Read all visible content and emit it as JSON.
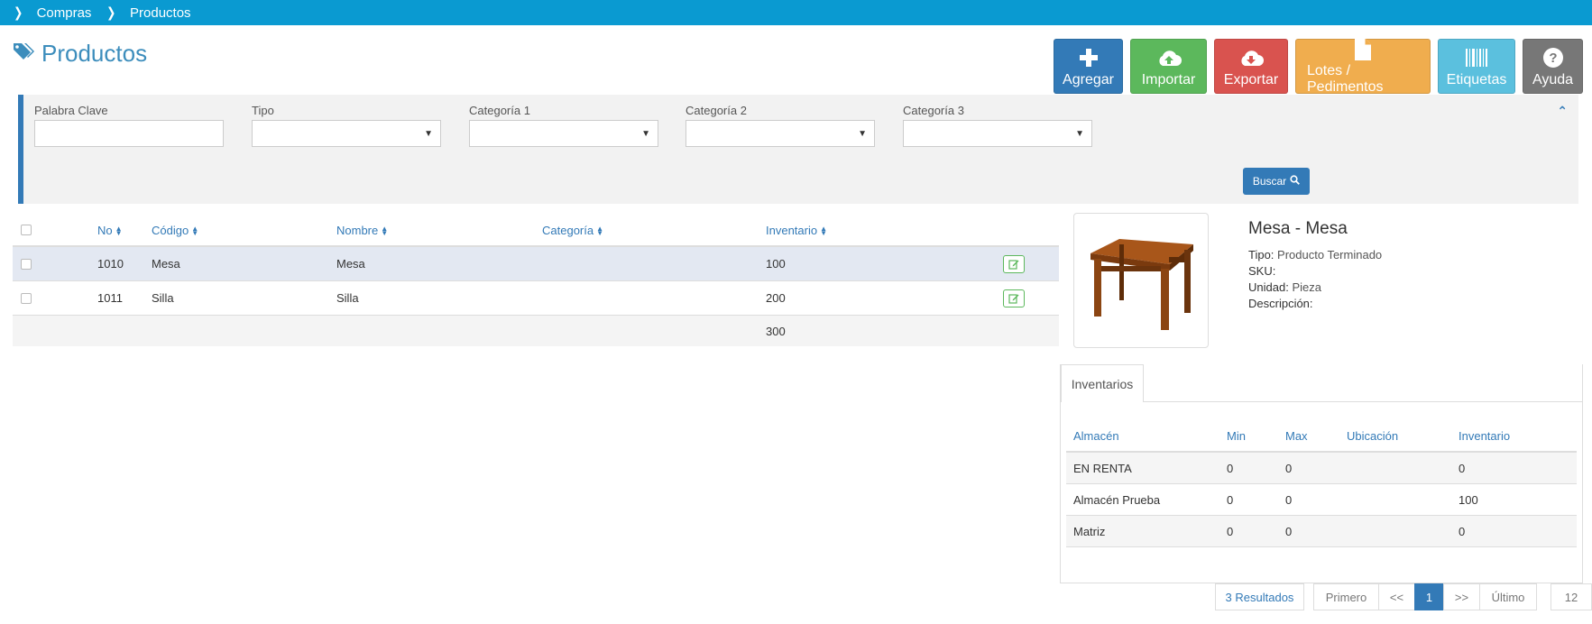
{
  "breadcrumb": {
    "items": [
      "Compras",
      "Productos"
    ]
  },
  "page": {
    "title": "Productos"
  },
  "toolbar": {
    "agregar": "Agregar",
    "importar": "Importar",
    "exportar": "Exportar",
    "lotes": "Lotes / Pedimentos",
    "etiquetas": "Etiquetas",
    "ayuda": "Ayuda"
  },
  "filters": {
    "keyword_label": "Palabra Clave",
    "tipo_label": "Tipo",
    "cat1_label": "Categoría 1",
    "cat2_label": "Categoría 2",
    "cat3_label": "Categoría 3",
    "search_button": "Buscar"
  },
  "grid": {
    "columns": {
      "no": "No",
      "codigo": "Código",
      "nombre": "Nombre",
      "categoria": "Categoría",
      "inventario": "Inventario"
    },
    "rows": [
      {
        "no": "1010",
        "codigo": "Mesa",
        "nombre": "Mesa",
        "categoria": "",
        "inventario": "100"
      },
      {
        "no": "1011",
        "codigo": "Silla",
        "nombre": "Silla",
        "categoria": "",
        "inventario": "200"
      }
    ],
    "total_inventario": "300"
  },
  "detail": {
    "title": "Mesa - Mesa",
    "tipo_label": "Tipo:",
    "tipo_value": "Producto Terminado",
    "sku_label": "SKU:",
    "unidad_label": "Unidad:",
    "unidad_value": "Pieza",
    "descripcion_label": "Descripción:"
  },
  "inventory": {
    "tab": "Inventarios",
    "columns": {
      "almacen": "Almacén",
      "min": "Min",
      "max": "Max",
      "ubicacion": "Ubicación",
      "inventario": "Inventario"
    },
    "rows": [
      {
        "almacen": "EN RENTA",
        "min": "0",
        "max": "0",
        "ubicacion": "",
        "inventario": "0"
      },
      {
        "almacen": "Almacén Prueba",
        "min": "0",
        "max": "0",
        "ubicacion": "",
        "inventario": "100"
      },
      {
        "almacen": "Matriz",
        "min": "0",
        "max": "0",
        "ubicacion": "",
        "inventario": "0"
      }
    ]
  },
  "pagination": {
    "results": "3 Resultados",
    "first": "Primero",
    "prev": "<<",
    "current": "1",
    "next": ">>",
    "last": "Último",
    "page_size": "12"
  },
  "colors": {
    "topbar": "#0a9ad1",
    "primary": "#337ab7",
    "success": "#5cb85c",
    "danger": "#d9534f",
    "warning": "#f0ad4e",
    "info": "#5bc0de",
    "default": "#777777"
  },
  "icons": [
    "chevron-right-icon",
    "tags-icon",
    "plus-icon",
    "cloud-upload-icon",
    "cloud-download-icon",
    "file-icon",
    "barcode-icon",
    "question-icon",
    "chevron-up-icon",
    "search-icon",
    "sort-icon",
    "edit-icon",
    "caret-down-icon"
  ]
}
